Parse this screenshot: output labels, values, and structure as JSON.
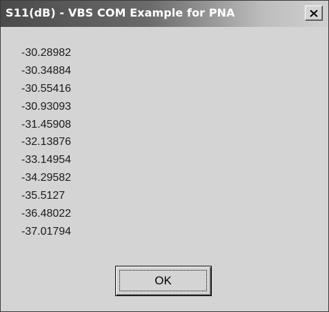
{
  "window": {
    "title": "S11(dB) - VBS COM Example for PNA",
    "close_icon": "close-x-icon"
  },
  "values": [
    "-30.28982",
    "-30.34884",
    "-30.55416",
    "-30.93093",
    "-31.45908",
    "-32.13876",
    "-33.14954",
    "-34.29582",
    "-35.5127",
    "-36.48022",
    "-37.01794"
  ],
  "buttons": {
    "ok_label": "OK"
  },
  "colors": {
    "dialog_background": "#d4d4d4",
    "titlebar_dark": "#4a4a4a",
    "titlebar_light": "#d0d0d0",
    "text": "#1a1a1a"
  }
}
